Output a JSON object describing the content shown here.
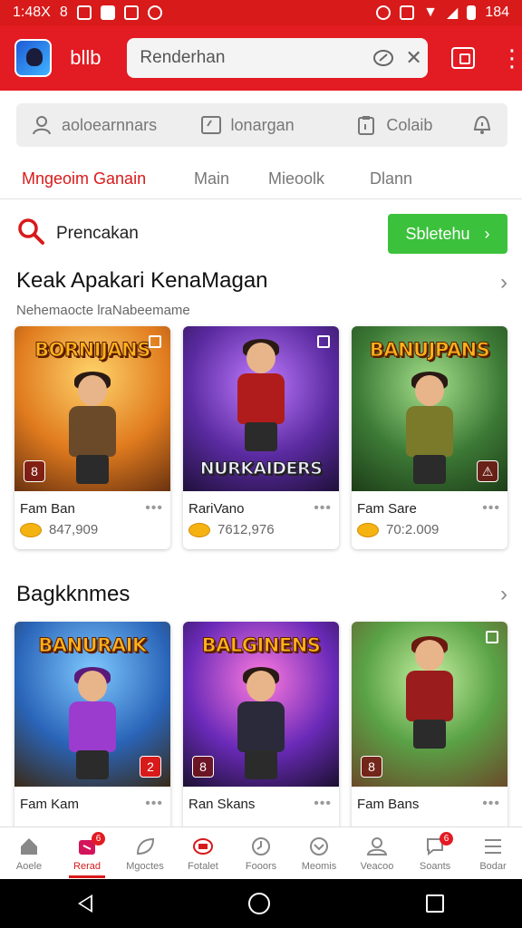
{
  "status": {
    "time": "1:48X",
    "misc": "8",
    "battery": "184"
  },
  "appbar": {
    "name": "bllb",
    "search_value": "Renderhan"
  },
  "quickbar": {
    "items": [
      {
        "label": "aoloearnnars",
        "icon": "user-icon"
      },
      {
        "label": "lonargan",
        "icon": "image-icon"
      },
      {
        "label": "Colaib",
        "icon": "clipboard-icon"
      },
      {
        "label": "",
        "icon": "alert-icon"
      }
    ]
  },
  "tabs": [
    {
      "label": "Mngeoim Ganain",
      "active": true
    },
    {
      "label": "Main",
      "active": false
    },
    {
      "label": "Mieoolk",
      "active": false
    },
    {
      "label": "Dlann",
      "active": false
    }
  ],
  "find": {
    "label": "Prencakan",
    "button": "Sbletehu"
  },
  "section1": {
    "title": "Keak Apakari KenaMagan",
    "subtitle": "Nehemaocte lraNabeemame",
    "cards": [
      {
        "art_title": "BORNIJANS",
        "name": "Fam Ban",
        "count": "847,909",
        "theme": "#e6a13b"
      },
      {
        "art_title": "NURKAIDERS",
        "name": "RariVano",
        "count": "7612,976",
        "theme": "#7a3fb8"
      },
      {
        "art_title": "BANUJPANS",
        "name": "Fam Sare",
        "count": "70:2.009",
        "theme": "#3f8e3a"
      }
    ]
  },
  "section2": {
    "title": "Bagkknmes",
    "cards": [
      {
        "art_title": "BANURAIK",
        "name": "Fam Kam",
        "theme": "#3d7fc9",
        "badge": "2"
      },
      {
        "art_title": "BALGINENS",
        "name": "Ran Skans",
        "theme": "#7b3fc0",
        "badge": "8"
      },
      {
        "art_title": "",
        "name": "Fam Bans",
        "theme": "#5aa246",
        "badge": "8"
      }
    ]
  },
  "bottomnav": [
    {
      "label": "Aoele",
      "icon": "home-icon",
      "active": false
    },
    {
      "label": "Rerad",
      "icon": "gift-icon",
      "active": true,
      "badge": "6"
    },
    {
      "label": "Mgoctes",
      "icon": "leaf-icon",
      "active": false
    },
    {
      "label": "Fotalet",
      "icon": "ticket-icon",
      "active": false
    },
    {
      "label": "Fooors",
      "icon": "clock-icon",
      "active": false
    },
    {
      "label": "Meomis",
      "icon": "ball-icon",
      "active": false
    },
    {
      "label": "Veacoo",
      "icon": "people-icon",
      "active": false
    },
    {
      "label": "Soants",
      "icon": "chat-icon",
      "active": false,
      "badge": "6"
    },
    {
      "label": "Bodar",
      "icon": "menu-icon",
      "active": false
    }
  ]
}
